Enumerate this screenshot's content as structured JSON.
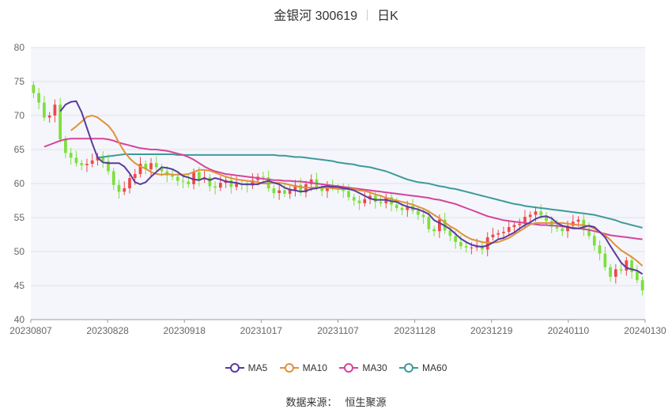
{
  "header": {
    "stock": "金银河 300619",
    "period": "日K"
  },
  "source": {
    "label": "数据来源：",
    "value": "恒生聚源"
  },
  "colors": {
    "up": "#f04848",
    "down": "#7ce03a",
    "ma5": "#5b3a9e",
    "ma10": "#e0913a",
    "ma30": "#d6449c",
    "ma60": "#3f9a9a"
  },
  "chart_data": {
    "type": "candlestick",
    "ylim": [
      40,
      80
    ],
    "yticks": [
      40,
      45,
      50,
      55,
      60,
      65,
      70,
      75,
      80
    ],
    "xticks": [
      "20230807",
      "20230828",
      "20230918",
      "20231017",
      "20231107",
      "20231128",
      "20231219",
      "20240110",
      "20240130"
    ],
    "legend": [
      "MA5",
      "MA10",
      "MA30",
      "MA60"
    ],
    "close": [
      73.3,
      71.9,
      69.7,
      70.0,
      71.6,
      66.5,
      64.5,
      63.8,
      63.0,
      62.7,
      62.9,
      63.4,
      64.0,
      63.3,
      61.8,
      59.8,
      58.8,
      59.3,
      60.8,
      61.4,
      62.9,
      62.1,
      63.0,
      62.4,
      61.8,
      61.2,
      61.0,
      60.4,
      60.3,
      59.9,
      61.7,
      60.6,
      60.9,
      59.6,
      59.4,
      60.1,
      60.5,
      59.5,
      60.0,
      59.8,
      59.7,
      60.5,
      61.0,
      60.9,
      59.3,
      58.6,
      59.0,
      58.5,
      59.1,
      59.8,
      58.7,
      59.9,
      60.6,
      59.5,
      58.9,
      59.6,
      59.4,
      59.3,
      58.9,
      58.0,
      57.5,
      57.1,
      57.7,
      58.2,
      57.3,
      57.1,
      58.0,
      56.9,
      56.4,
      56.1,
      56.7,
      56.0,
      55.4,
      55.1,
      53.3,
      53.0,
      54.7,
      53.1,
      52.3,
      51.4,
      50.8,
      50.6,
      50.6,
      50.9,
      50.3,
      52.1,
      52.5,
      52.7,
      52.9,
      53.6,
      53.9,
      54.1,
      55.1,
      55.4,
      55.9,
      55.3,
      54.5,
      53.7,
      53.4,
      53.0,
      53.8,
      54.4,
      54.7,
      53.3,
      52.3,
      50.9,
      49.7,
      47.7,
      46.3,
      47.4,
      47.2,
      48.7,
      47.0,
      45.8,
      44.3
    ],
    "ma5": [
      70.6,
      71.6,
      72.0,
      72.1,
      70.5,
      68.2,
      65.9,
      63.8,
      63.1,
      63.0,
      63.0,
      63.0,
      62.5,
      61.5,
      60.2,
      59.9,
      60.2,
      61.0,
      61.7,
      62.4,
      62.3,
      62.1,
      61.7,
      61.1,
      60.9,
      60.6,
      60.5,
      60.8,
      60.5,
      60.8,
      60.6,
      60.3,
      60.2,
      60.1,
      59.9,
      59.9,
      59.9,
      59.9,
      60.2,
      60.4,
      60.1,
      59.9,
      59.4,
      59.1,
      59.0,
      58.8,
      58.9,
      59.2,
      59.3,
      59.5,
      59.6,
      59.5,
      59.5,
      59.3,
      59.2,
      59.0,
      58.6,
      58.2,
      57.8,
      57.6,
      57.6,
      57.6,
      57.4,
      57.3,
      56.9,
      56.6,
      56.4,
      56.2,
      55.9,
      55.5,
      54.6,
      54.2,
      53.8,
      53.3,
      52.6,
      51.9,
      51.4,
      51.0,
      50.8,
      50.7,
      50.9,
      51.3,
      51.8,
      52.0,
      52.4,
      52.8,
      53.4,
      53.9,
      54.3,
      54.8,
      55.1,
      55.2,
      54.9,
      54.2,
      53.8,
      53.6,
      53.4,
      53.4,
      53.6,
      53.8,
      53.6,
      52.9,
      52.1,
      50.8,
      49.6,
      48.4,
      47.6,
      47.4,
      47.2,
      46.7
    ],
    "ma10": [
      67.8,
      68.4,
      69.1,
      69.8,
      70.0,
      69.7,
      69.1,
      68.5,
      67.5,
      66.0,
      64.7,
      63.7,
      63.0,
      62.5,
      62.2,
      61.7,
      61.4,
      61.3,
      61.4,
      61.3,
      61.3,
      61.3,
      61.4,
      61.7,
      62.0,
      62.0,
      61.9,
      61.6,
      61.3,
      61.0,
      60.8,
      60.6,
      60.5,
      60.4,
      60.3,
      60.2,
      60.0,
      60.0,
      60.1,
      60.1,
      60.0,
      59.8,
      59.6,
      59.5,
      59.4,
      59.4,
      59.4,
      59.4,
      59.4,
      59.3,
      59.2,
      59.2,
      59.2,
      59.2,
      59.0,
      58.9,
      58.7,
      58.4,
      58.2,
      57.9,
      57.7,
      57.5,
      57.3,
      57.1,
      56.9,
      56.6,
      56.3,
      55.9,
      55.4,
      54.9,
      54.3,
      53.7,
      53.3,
      52.7,
      52.2,
      51.8,
      51.6,
      51.4,
      51.3,
      51.3,
      51.4,
      51.7,
      52.0,
      52.5,
      53.0,
      53.5,
      54.0,
      54.2,
      54.2,
      54.2,
      54.2,
      54.2,
      54.2,
      54.1,
      54.0,
      53.9,
      53.9,
      53.7,
      53.4,
      52.9,
      52.4,
      51.7,
      50.9,
      50.2,
      49.7,
      49.2,
      48.6,
      47.9
    ],
    "ma30": [
      65.4,
      65.7,
      66.0,
      66.3,
      66.5,
      66.6,
      66.6,
      66.6,
      66.6,
      66.6,
      66.6,
      66.6,
      66.5,
      66.3,
      66.0,
      65.8,
      65.6,
      65.4,
      65.2,
      65.1,
      65.0,
      65.0,
      64.9,
      64.8,
      64.6,
      64.4,
      64.2,
      63.9,
      63.5,
      63.0,
      62.5,
      62.1,
      61.8,
      61.6,
      61.4,
      61.3,
      61.2,
      61.1,
      61.0,
      60.9,
      60.8,
      60.7,
      60.6,
      60.5,
      60.5,
      60.4,
      60.4,
      60.3,
      60.3,
      60.2,
      60.1,
      60.0,
      59.9,
      59.8,
      59.7,
      59.6,
      59.5,
      59.4,
      59.3,
      59.2,
      59.1,
      59.0,
      58.9,
      58.8,
      58.7,
      58.6,
      58.5,
      58.4,
      58.3,
      58.2,
      58.1,
      58.0,
      57.9,
      57.7,
      57.6,
      57.4,
      57.2,
      57.0,
      56.7,
      56.4,
      56.1,
      55.8,
      55.5,
      55.2,
      55.0,
      54.8,
      54.6,
      54.5,
      54.4,
      54.3,
      54.2,
      54.1,
      54.0,
      53.9,
      53.9,
      53.8,
      53.8,
      53.7,
      53.6,
      53.5,
      53.4,
      53.3,
      53.2,
      53.0,
      52.8,
      52.6,
      52.4,
      52.3,
      52.2,
      52.1,
      52.0,
      51.9,
      51.8
    ],
    "ma60": [
      63.8,
      63.9,
      64.0,
      64.1,
      64.2,
      64.3,
      64.3,
      64.3,
      64.3,
      64.3,
      64.3,
      64.3,
      64.3,
      64.3,
      64.3,
      64.2,
      64.2,
      64.2,
      64.2,
      64.2,
      64.2,
      64.2,
      64.2,
      64.2,
      64.2,
      64.2,
      64.2,
      64.2,
      64.2,
      64.2,
      64.2,
      64.2,
      64.2,
      64.2,
      64.1,
      64.1,
      64.0,
      63.9,
      63.9,
      63.8,
      63.7,
      63.6,
      63.5,
      63.4,
      63.3,
      63.1,
      63.0,
      62.9,
      62.8,
      62.6,
      62.5,
      62.4,
      62.2,
      62.0,
      61.8,
      61.5,
      61.2,
      60.9,
      60.6,
      60.4,
      60.2,
      60.1,
      60.0,
      59.8,
      59.6,
      59.5,
      59.3,
      59.2,
      59.0,
      58.8,
      58.6,
      58.4,
      58.2,
      58.0,
      57.8,
      57.6,
      57.4,
      57.2,
      57.0,
      56.9,
      56.7,
      56.6,
      56.5,
      56.4,
      56.3,
      56.2,
      56.1,
      56.0,
      55.9,
      55.8,
      55.7,
      55.6,
      55.5,
      55.4,
      55.2,
      55.0,
      54.8,
      54.6,
      54.3,
      54.1,
      53.9,
      53.7,
      53.5
    ]
  }
}
